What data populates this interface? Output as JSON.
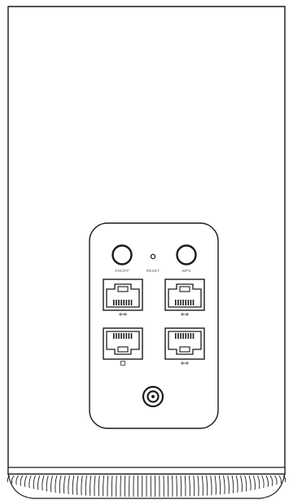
{
  "device": {
    "labels": {
      "onoff": "ON/OFF",
      "reset": "RESET",
      "wps": "WPS"
    },
    "port_icons": [
      "lan-port-icon",
      "lan-port-icon",
      "wan-port-icon",
      "lan-port-icon"
    ],
    "colors": {
      "stroke": "#1a1a1a",
      "body": "#ffffff",
      "background": "#ffffff"
    }
  }
}
